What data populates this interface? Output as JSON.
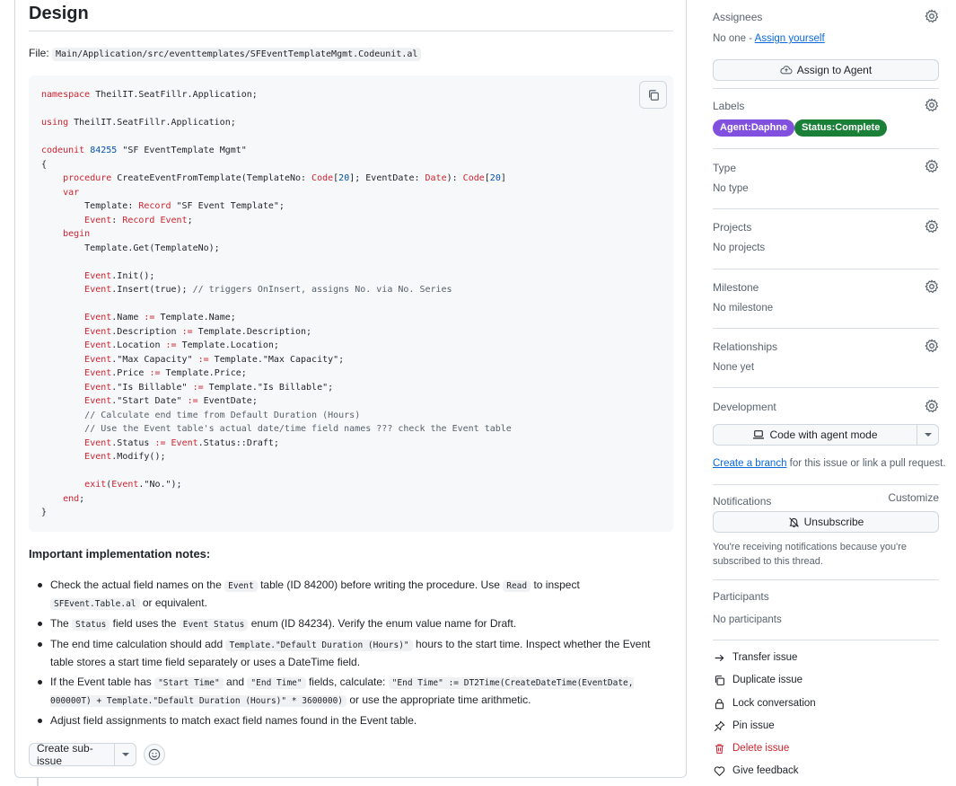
{
  "main": {
    "heading": "Design",
    "file_label": "File: ",
    "file_path": "Main/Application/src/eventtemplates/SFEventTemplateMgmt.Codeunit.al",
    "code_lines": [
      [
        [
          "k",
          "namespace"
        ],
        [
          "t",
          " TheilIT.SeatFillr.Application;"
        ]
      ],
      [],
      [
        [
          "k",
          "using"
        ],
        [
          "t",
          " TheilIT.SeatFillr.Application;"
        ]
      ],
      [],
      [
        [
          "k",
          "codeunit"
        ],
        [
          "t",
          " "
        ],
        [
          "n",
          "84255"
        ],
        [
          "t",
          " \"SF EventTemplate Mgmt\""
        ]
      ],
      [
        [
          "t",
          "{"
        ]
      ],
      [
        [
          "t",
          "    "
        ],
        [
          "k",
          "procedure"
        ],
        [
          "t",
          " CreateEventFromTemplate(TemplateNo: "
        ],
        [
          "k",
          "Code"
        ],
        [
          "t",
          "["
        ],
        [
          "n",
          "20"
        ],
        [
          "t",
          "]; EventDate: "
        ],
        [
          "k",
          "Date"
        ],
        [
          "t",
          "): "
        ],
        [
          "k",
          "Code"
        ],
        [
          "t",
          "["
        ],
        [
          "n",
          "20"
        ],
        [
          "t",
          "]"
        ]
      ],
      [
        [
          "t",
          "    "
        ],
        [
          "k",
          "var"
        ]
      ],
      [
        [
          "t",
          "        Template: "
        ],
        [
          "k",
          "Record"
        ],
        [
          "t",
          " \"SF Event Template\";"
        ]
      ],
      [
        [
          "t",
          "        "
        ],
        [
          "k",
          "Event"
        ],
        [
          "t",
          ": "
        ],
        [
          "k",
          "Record"
        ],
        [
          "t",
          " "
        ],
        [
          "k",
          "Event"
        ],
        [
          "t",
          ";"
        ]
      ],
      [
        [
          "t",
          "    "
        ],
        [
          "k",
          "begin"
        ]
      ],
      [
        [
          "t",
          "        Template.Get(TemplateNo);"
        ]
      ],
      [],
      [
        [
          "t",
          "        "
        ],
        [
          "k",
          "Event"
        ],
        [
          "t",
          ".Init();"
        ]
      ],
      [
        [
          "t",
          "        "
        ],
        [
          "k",
          "Event"
        ],
        [
          "t",
          ".Insert(true); "
        ],
        [
          "c",
          "// triggers OnInsert, assigns No. via No. Series"
        ]
      ],
      [],
      [
        [
          "t",
          "        "
        ],
        [
          "k",
          "Event"
        ],
        [
          "t",
          ".Name "
        ],
        [
          "k",
          ":="
        ],
        [
          "t",
          " Template.Name;"
        ]
      ],
      [
        [
          "t",
          "        "
        ],
        [
          "k",
          "Event"
        ],
        [
          "t",
          ".Description "
        ],
        [
          "k",
          ":="
        ],
        [
          "t",
          " Template.Description;"
        ]
      ],
      [
        [
          "t",
          "        "
        ],
        [
          "k",
          "Event"
        ],
        [
          "t",
          ".Location "
        ],
        [
          "k",
          ":="
        ],
        [
          "t",
          " Template.Location;"
        ]
      ],
      [
        [
          "t",
          "        "
        ],
        [
          "k",
          "Event"
        ],
        [
          "t",
          ".\"Max Capacity\" "
        ],
        [
          "k",
          ":="
        ],
        [
          "t",
          " Template.\"Max Capacity\";"
        ]
      ],
      [
        [
          "t",
          "        "
        ],
        [
          "k",
          "Event"
        ],
        [
          "t",
          ".Price "
        ],
        [
          "k",
          ":="
        ],
        [
          "t",
          " Template.Price;"
        ]
      ],
      [
        [
          "t",
          "        "
        ],
        [
          "k",
          "Event"
        ],
        [
          "t",
          ".\"Is Billable\" "
        ],
        [
          "k",
          ":="
        ],
        [
          "t",
          " Template.\"Is Billable\";"
        ]
      ],
      [
        [
          "t",
          "        "
        ],
        [
          "k",
          "Event"
        ],
        [
          "t",
          ".\"Start Date\" "
        ],
        [
          "k",
          ":="
        ],
        [
          "t",
          " EventDate;"
        ]
      ],
      [
        [
          "t",
          "        "
        ],
        [
          "c",
          "// Calculate end time from Default Duration (Hours)"
        ]
      ],
      [
        [
          "t",
          "        "
        ],
        [
          "c",
          "// Use the Event table's actual date/time field names ??? check the Event table"
        ]
      ],
      [
        [
          "t",
          "        "
        ],
        [
          "k",
          "Event"
        ],
        [
          "t",
          ".Status "
        ],
        [
          "k",
          ":="
        ],
        [
          "t",
          " "
        ],
        [
          "k",
          "Event"
        ],
        [
          "t",
          ".Status::Draft;"
        ]
      ],
      [
        [
          "t",
          "        "
        ],
        [
          "k",
          "Event"
        ],
        [
          "t",
          ".Modify();"
        ]
      ],
      [],
      [
        [
          "t",
          "        "
        ],
        [
          "k",
          "exit"
        ],
        [
          "t",
          "("
        ],
        [
          "k",
          "Event"
        ],
        [
          "t",
          ".\"No.\");"
        ]
      ],
      [
        [
          "t",
          "    "
        ],
        [
          "k",
          "end"
        ],
        [
          "t",
          ";"
        ]
      ],
      [
        [
          "t",
          "}"
        ]
      ]
    ],
    "notes_heading": "Important implementation notes:",
    "notes": [
      [
        [
          "t",
          "Check the actual field names on the "
        ],
        [
          "m",
          "Event"
        ],
        [
          "t",
          " table (ID 84200) before writing the procedure. Use "
        ],
        [
          "m",
          "Read"
        ],
        [
          "t",
          " to inspect "
        ],
        [
          "m",
          "SFEvent.Table.al"
        ],
        [
          "t",
          " or equivalent."
        ]
      ],
      [
        [
          "t",
          "The "
        ],
        [
          "m",
          "Status"
        ],
        [
          "t",
          " field uses the "
        ],
        [
          "m",
          "Event Status"
        ],
        [
          "t",
          " enum (ID 84234). Verify the enum value name for Draft."
        ]
      ],
      [
        [
          "t",
          "The end time calculation should add "
        ],
        [
          "m",
          "Template.\"Default Duration (Hours)\""
        ],
        [
          "t",
          " hours to the start time. Inspect whether the Event table stores a start time field separately or uses a DateTime field."
        ]
      ],
      [
        [
          "t",
          "If the Event table has "
        ],
        [
          "m",
          "\"Start Time\""
        ],
        [
          "t",
          " and "
        ],
        [
          "m",
          "\"End Time\""
        ],
        [
          "t",
          " fields, calculate: "
        ],
        [
          "m",
          "\"End Time\" := DT2Time(CreateDateTime(EventDate, 000000T) + Template.\"Default Duration (Hours)\" * 3600000)"
        ],
        [
          "t",
          " or use the appropriate time arithmetic."
        ]
      ],
      [
        [
          "t",
          "Adjust field assignments to match exact field names found in the Event table."
        ]
      ]
    ],
    "create_sub_issue_label": "Create sub-issue"
  },
  "sidebar": {
    "assignees": {
      "title": "Assignees",
      "value_prefix": "No one - ",
      "assign_link": "Assign yourself",
      "agent_button": "Assign to Agent"
    },
    "labels": {
      "title": "Labels",
      "items": [
        {
          "text": "Agent:Daphne",
          "color": "#8250df"
        },
        {
          "text": "Status:Complete",
          "color": "#1a7f37"
        }
      ]
    },
    "type": {
      "title": "Type",
      "value": "No type"
    },
    "projects": {
      "title": "Projects",
      "value": "No projects"
    },
    "milestone": {
      "title": "Milestone",
      "value": "No milestone"
    },
    "relationships": {
      "title": "Relationships",
      "value": "None yet"
    },
    "development": {
      "title": "Development",
      "button": "Code with agent mode",
      "branch_link": "Create a branch",
      "branch_suffix": " for this issue or link a pull request."
    },
    "notifications": {
      "title": "Notifications",
      "customize": "Customize",
      "button": "Unsubscribe",
      "info": "You're receiving notifications because you're subscribed to this thread."
    },
    "participants": {
      "title": "Participants",
      "value": "No participants"
    },
    "actions": {
      "transfer": "Transfer issue",
      "duplicate": "Duplicate issue",
      "lock": "Lock conversation",
      "pin": "Pin issue",
      "delete": "Delete issue",
      "feedback": "Give feedback"
    }
  },
  "colors": {
    "accent": "#0969da",
    "danger": "#cf222e",
    "border": "#d0d7de",
    "muted": "#59636e"
  }
}
